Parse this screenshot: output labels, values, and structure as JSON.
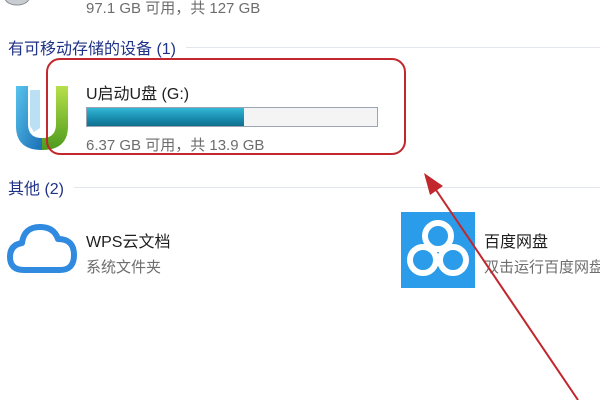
{
  "top_drive": {
    "caption": "97.1 GB 可用，共 127 GB"
  },
  "removable_section": {
    "title": "有可移动存储的设备 (1)",
    "drive": {
      "name": "U启动U盘 (G:)",
      "used_fraction": 0.54,
      "caption": "6.37 GB 可用，共 13.9 GB",
      "bar_color": "#1a8eb0"
    }
  },
  "other_section": {
    "title": "其他 (2)",
    "items": [
      {
        "name": "WPS云文档",
        "subtitle": "系统文件夹",
        "icon": "cloud-icon"
      },
      {
        "name": "百度网盘",
        "subtitle": "双击运行百度网盘",
        "icon": "baidu-netdisk-icon"
      }
    ]
  },
  "annotation": {
    "color": "#c1272d"
  }
}
